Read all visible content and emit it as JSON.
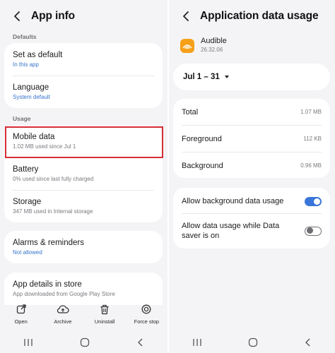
{
  "left": {
    "title": "App info",
    "sections": {
      "defaults": "Defaults",
      "usage": "Usage"
    },
    "items": {
      "set_default": {
        "title": "Set as default",
        "sub": "In this app"
      },
      "language": {
        "title": "Language",
        "sub": "System default"
      },
      "mobile_data": {
        "title": "Mobile data",
        "sub": "1.02 MB used since Jul 1"
      },
      "battery": {
        "title": "Battery",
        "sub": "0% used since last fully charged"
      },
      "storage": {
        "title": "Storage",
        "sub": "347 MB used in Internal storage"
      },
      "alarms": {
        "title": "Alarms & reminders",
        "sub": "Not allowed"
      },
      "store": {
        "title": "App details in store",
        "sub": "App downloaded from Google Play Store"
      }
    },
    "actions": [
      "Open",
      "Archive",
      "Uninstall",
      "Force stop"
    ],
    "highlight_color": "#d62d36"
  },
  "right": {
    "title": "Application data usage",
    "app": {
      "name": "Audible",
      "version": "26.32.06",
      "icon": "audible-icon",
      "icon_color": "#f6a01a"
    },
    "date_range": "Jul 1 – 31",
    "usage": [
      {
        "label": "Total",
        "value": "1.07 MB"
      },
      {
        "label": "Foreground",
        "value": "112 KB"
      },
      {
        "label": "Background",
        "value": "0.96 MB"
      }
    ],
    "toggles": {
      "background": {
        "label": "Allow background data usage",
        "on": true
      },
      "saver": {
        "label": "Allow data usage while Data saver is on",
        "on": false
      }
    },
    "accent": "#3a76d9"
  }
}
